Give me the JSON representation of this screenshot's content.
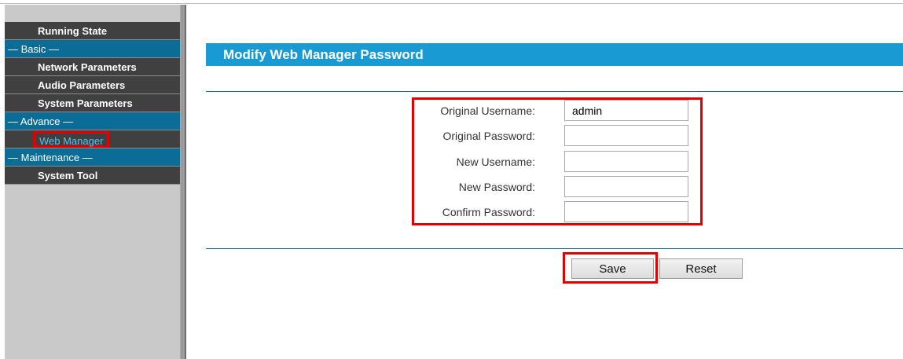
{
  "sidebar": {
    "items": [
      {
        "type": "item",
        "label": "Running State"
      },
      {
        "type": "section",
        "label": "— Basic —"
      },
      {
        "type": "item",
        "label": "Network Parameters"
      },
      {
        "type": "item",
        "label": "Audio Parameters"
      },
      {
        "type": "item",
        "label": "System Parameters"
      },
      {
        "type": "section",
        "label": "— Advance —"
      },
      {
        "type": "active",
        "label": "Web Manager"
      },
      {
        "type": "section",
        "label": "— Maintenance —"
      },
      {
        "type": "item",
        "label": "System Tool"
      }
    ]
  },
  "main": {
    "title": "Modify Web Manager Password",
    "fields": [
      {
        "label": "Original Username:",
        "value": "admin"
      },
      {
        "label": "Original Password:",
        "value": ""
      },
      {
        "label": "New Username:",
        "value": ""
      },
      {
        "label": "New Password:",
        "value": ""
      },
      {
        "label": "Confirm Password:",
        "value": ""
      }
    ],
    "buttons": {
      "save": "Save",
      "reset": "Reset"
    }
  },
  "colors": {
    "accent": "#1a9ad2",
    "section": "#0b6d96",
    "menu_item": "#404040",
    "highlight": "#e00000",
    "active_text": "#4fc3f7"
  }
}
